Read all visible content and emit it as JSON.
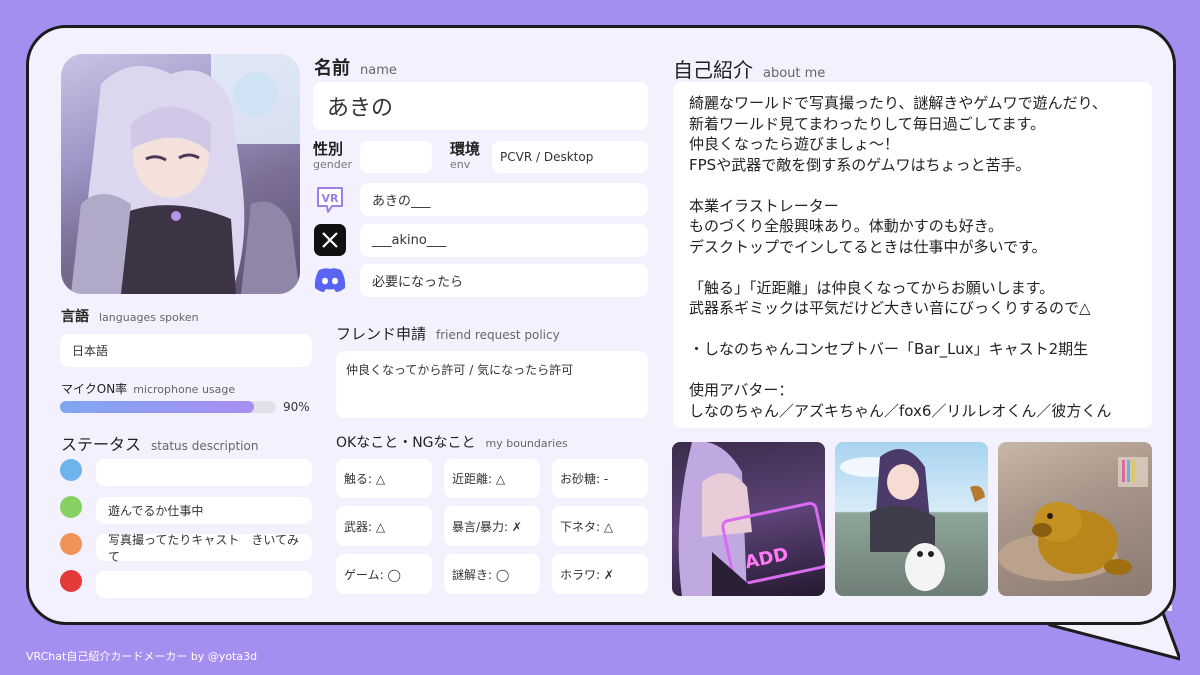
{
  "name": {
    "label_ja": "名前",
    "label_en": "name",
    "value": "あきの"
  },
  "gender": {
    "label_ja": "性別",
    "label_en": "gender",
    "value": ""
  },
  "env": {
    "label_ja": "環境",
    "label_en": "env",
    "value": "PCVR / Desktop"
  },
  "socials": [
    {
      "icon": "vrchat-icon",
      "value": "あきの___"
    },
    {
      "icon": "x-icon",
      "value": "___akino___"
    },
    {
      "icon": "discord-icon",
      "value": "必要になったら"
    }
  ],
  "languages": {
    "label_ja": "言語",
    "label_en": "languages spoken",
    "value": "日本語"
  },
  "mic": {
    "label_ja": "マイクON率",
    "label_en": "microphone usage",
    "percent": 90,
    "percent_text": "90%"
  },
  "friend": {
    "label_ja": "フレンド申請",
    "label_en": "friend request policy",
    "value": "仲良くなってから許可 / 気になったら許可"
  },
  "status": {
    "label_ja": "ステータス",
    "label_en": "status description",
    "items": [
      {
        "color": "#6db3ec",
        "text": ""
      },
      {
        "color": "#86d162",
        "text": "遊んでるか仕事中"
      },
      {
        "color": "#f0925a",
        "text": "写真撮ってたりキャスト　きいてみて"
      },
      {
        "color": "#e63a3a",
        "text": ""
      }
    ]
  },
  "boundaries": {
    "label_ja": "OKなこと・NGなこと",
    "label_en": "my boundaries",
    "items": [
      "触る: △",
      "近距離: △",
      "お砂糖: -",
      "武器: △",
      "暴言/暴力: ✗",
      "下ネタ: △",
      "ゲーム: ◯",
      "謎解き: ◯",
      "ホラワ: ✗"
    ]
  },
  "about": {
    "label_ja": "自己紹介",
    "label_en": "about me",
    "text": "綺麗なワールドで写真撮ったり、謎解きやゲムワで遊んだり、\n新着ワールド見てまわったりして毎日過ごしてます。\n仲良くなったら遊びましょ～！\nFPSや武器で敵を倒す系のゲムワはちょっと苦手。\n\n本業イラストレーター\nものづくり全般興味あり。体動かすのも好き。\nデスクトップでインしてるときは仕事中が多いです。\n\n「触る」「近距離」は仲良くなってからお願いします。\n武器系ギミックは平気だけど大きい音にびっくりするので△\n\n・しなのちゃんコンセプトバー「Bar_Lux」キャスト2期生\n\n使用アバター：\nしなのちゃん／アズキちゃん／fox6／リルレオくん／彼方くん"
  },
  "photos": [
    {
      "name": "photo-avatar-neon",
      "neon_text": "ADD"
    },
    {
      "name": "photo-avatar-outdoor"
    },
    {
      "name": "photo-bear-room"
    }
  ],
  "footer": "VRChat自己紹介カードメーカー by @yota3d"
}
